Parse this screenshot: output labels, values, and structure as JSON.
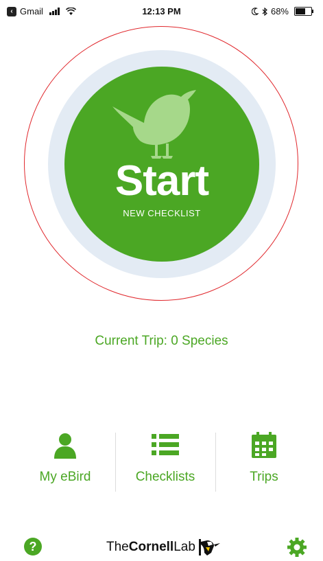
{
  "status_bar": {
    "carrier": "Gmail",
    "time": "12:13 PM",
    "battery": "68%",
    "battery_level": 0.68,
    "icons": [
      "back-to-app-icon",
      "cellular-signal-icon",
      "wifi-icon",
      "moon-icon",
      "bluetooth-icon",
      "battery-icon"
    ]
  },
  "start": {
    "label": "Start",
    "sublabel": "NEW CHECKLIST",
    "icon": "bird-icon"
  },
  "current_trip": {
    "label": "Current Trip: 0 Species"
  },
  "nav": {
    "items": [
      {
        "label": "My eBird",
        "icon": "person-icon"
      },
      {
        "label": "Checklists",
        "icon": "list-icon"
      },
      {
        "label": "Trips",
        "icon": "calendar-icon"
      }
    ]
  },
  "footer": {
    "logo_text": "TheCornellLab",
    "help_icon": "help-icon",
    "settings_icon": "gear-icon"
  },
  "colors": {
    "brand_green": "#4ba724",
    "halo": "#e3ebf4",
    "ring": "#e0262b"
  }
}
